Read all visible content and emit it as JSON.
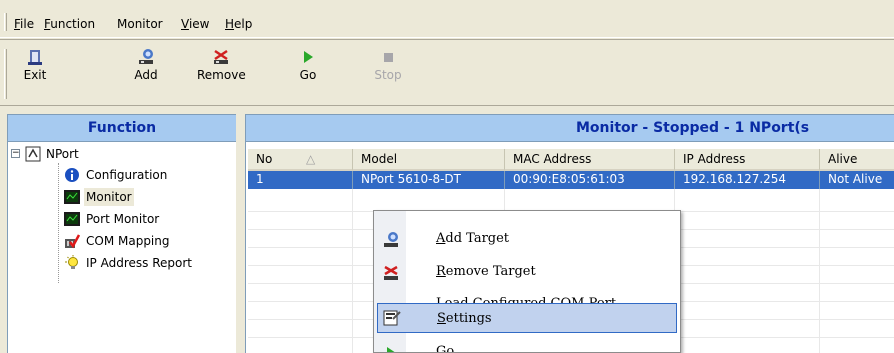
{
  "menubar": {
    "items": [
      {
        "pre": "",
        "u": "F",
        "post": "ile"
      },
      {
        "pre": "",
        "u": "F",
        "post": "unction"
      },
      {
        "pre": "Monitor",
        "u": "",
        "post": ""
      },
      {
        "pre": "",
        "u": "V",
        "post": "iew"
      },
      {
        "pre": "",
        "u": "H",
        "post": "elp"
      }
    ]
  },
  "toolbar": {
    "exit": "Exit",
    "add": "Add",
    "remove": "Remove",
    "go": "Go",
    "stop": "Stop"
  },
  "function_panel": {
    "title": "Function",
    "root": "NPort",
    "items": [
      "Configuration",
      "Monitor",
      "Port Monitor",
      "COM Mapping",
      "IP Address Report"
    ]
  },
  "monitor_panel": {
    "title": "Monitor - Stopped - 1 NPort(s",
    "columns": [
      "No",
      "Model",
      "MAC Address",
      "IP Address",
      "Alive"
    ],
    "rows": [
      {
        "no": "1",
        "model": "NPort 5610-8-DT",
        "mac": "00:90:E8:05:61:03",
        "ip": "192.168.127.254",
        "alive": "Not Alive"
      }
    ]
  },
  "context_menu": {
    "add_target": {
      "u": "A",
      "rest": "dd Target"
    },
    "remove_target": {
      "u": "R",
      "rest": "emove Target"
    },
    "load_com": {
      "u": "L",
      "rest": "oad Configured COM Port"
    },
    "settings": {
      "u": "S",
      "rest": "ettings"
    },
    "go": {
      "u": "G",
      "rest": "o"
    }
  },
  "colors": {
    "panel_header_bg": "#a6caf0",
    "panel_header_text": "#0a2ba4",
    "selection": "#316ac5"
  }
}
